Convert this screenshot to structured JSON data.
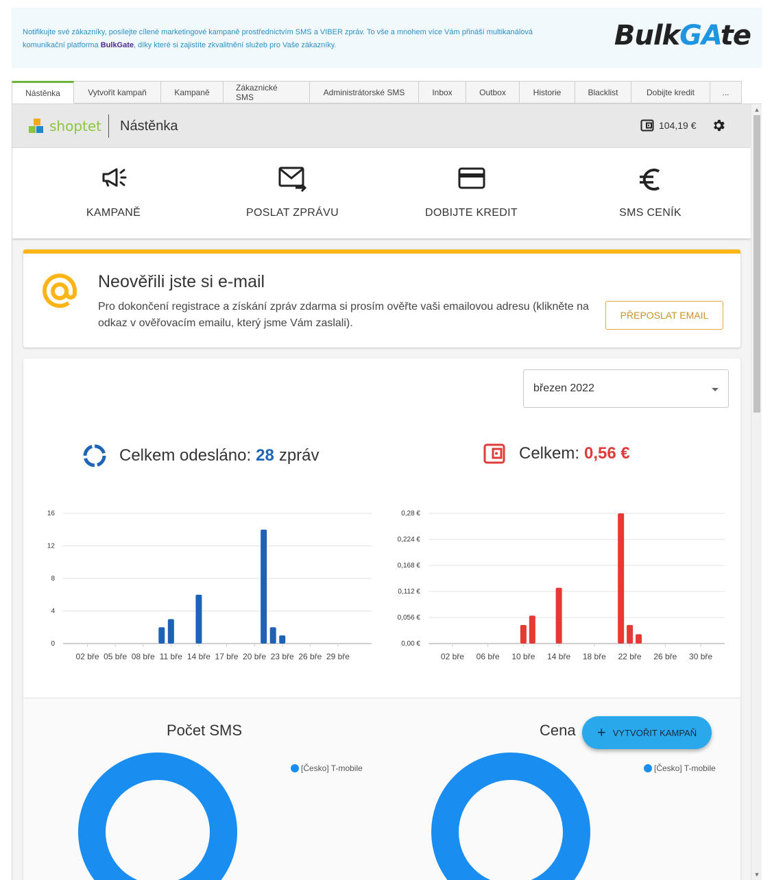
{
  "banner": {
    "text_part1": "Notifikujte své zákazníky, posílejte cílené marketingové kampaně prostřednictvím SMS a VIBER zpráv. To vše a mnohem více Vám přináší multikanálová komunikační platforma ",
    "brand_inline": "BulkGate",
    "text_part2": ", díky které si zajistíte zkvalitnění služeb pro Vaše zákazníky.",
    "logo_a": "Bulk",
    "logo_b": "GA",
    "logo_c": "te"
  },
  "tabs": [
    {
      "label": "Nástěnka",
      "active": true
    },
    {
      "label": "Vytvořit kampaň"
    },
    {
      "label": "Kampaně"
    },
    {
      "label": "Zákaznické SMS"
    },
    {
      "label": "Administrátorské SMS"
    },
    {
      "label": "Inbox"
    },
    {
      "label": "Outbox"
    },
    {
      "label": "Historie"
    },
    {
      "label": "Blacklist"
    },
    {
      "label": "Dobijte kredit"
    },
    {
      "label": "..."
    }
  ],
  "header": {
    "brand": "shoptet",
    "title": "Nástěnka",
    "credit": "104,19 €"
  },
  "quick_actions": [
    {
      "label": "KAMPANĚ",
      "icon": "megaphone-icon"
    },
    {
      "label": "POSLAT ZPRÁVU",
      "icon": "send-mail-icon"
    },
    {
      "label": "DOBIJTE KREDIT",
      "icon": "credit-card-icon"
    },
    {
      "label": "SMS CENÍK",
      "icon": "euro-icon"
    }
  ],
  "email_notice": {
    "title": "Neověřili jste si e-mail",
    "body": "Pro dokončení registrace a získání zpráv zdarma si prosím ověřte vaši emailovou adresu (klikněte na odkaz v ověřovacím emailu, který jsme Vám zaslali).",
    "button": "PŘEPOSLAT EMAIL",
    "accent": "#fbb516"
  },
  "stats": {
    "month": "březen 2022",
    "sent_label": "Celkem odesláno:",
    "sent_value": "28",
    "sent_unit": "zpráv",
    "cost_label": "Celkem:",
    "cost_value": "0,56 €",
    "pie_left_title": "Počet SMS",
    "pie_right_title": "Cena",
    "legend_label": "[Česko] T-mobile"
  },
  "fab": {
    "label": "VYTVOŘIT KAMPAŇ"
  },
  "chart_data": [
    {
      "type": "bar",
      "color": "#1e62b8",
      "x_tick_labels": [
        "02 bře",
        "05 bře",
        "08 bře",
        "11 bře",
        "14 bře",
        "17 bře",
        "20 bře",
        "23 bře",
        "26 bře",
        "29 bře"
      ],
      "y_tick_labels": [
        "0",
        "4",
        "8",
        "12",
        "16"
      ],
      "ylim": [
        0,
        16
      ],
      "days": [
        1,
        31
      ],
      "x": [
        10,
        11,
        14,
        21,
        22,
        23
      ],
      "values": [
        2,
        3,
        6,
        14,
        2,
        1
      ]
    },
    {
      "type": "bar",
      "color": "#e53935",
      "x_tick_labels": [
        "02 bře",
        "06 bře",
        "10 bře",
        "14 bře",
        "18 bře",
        "22 bře",
        "26 bře",
        "30 bře"
      ],
      "y_tick_labels": [
        "0,00 €",
        "0,056 €",
        "0,112 €",
        "0,168 €",
        "0,224 €",
        "0,28 €"
      ],
      "ylim": [
        0,
        0.28
      ],
      "days": [
        1,
        31
      ],
      "x": [
        10,
        11,
        14,
        21,
        22,
        23
      ],
      "values": [
        0.04,
        0.06,
        0.12,
        0.28,
        0.04,
        0.02
      ]
    },
    {
      "type": "pie",
      "title": "Počet SMS",
      "labels": [
        "[Česko] T-mobile"
      ],
      "values": [
        28
      ],
      "color": "#1a8ef0"
    },
    {
      "type": "pie",
      "title": "Cena",
      "labels": [
        "[Česko] T-mobile"
      ],
      "values": [
        0.56
      ],
      "color": "#1a8ef0"
    }
  ]
}
